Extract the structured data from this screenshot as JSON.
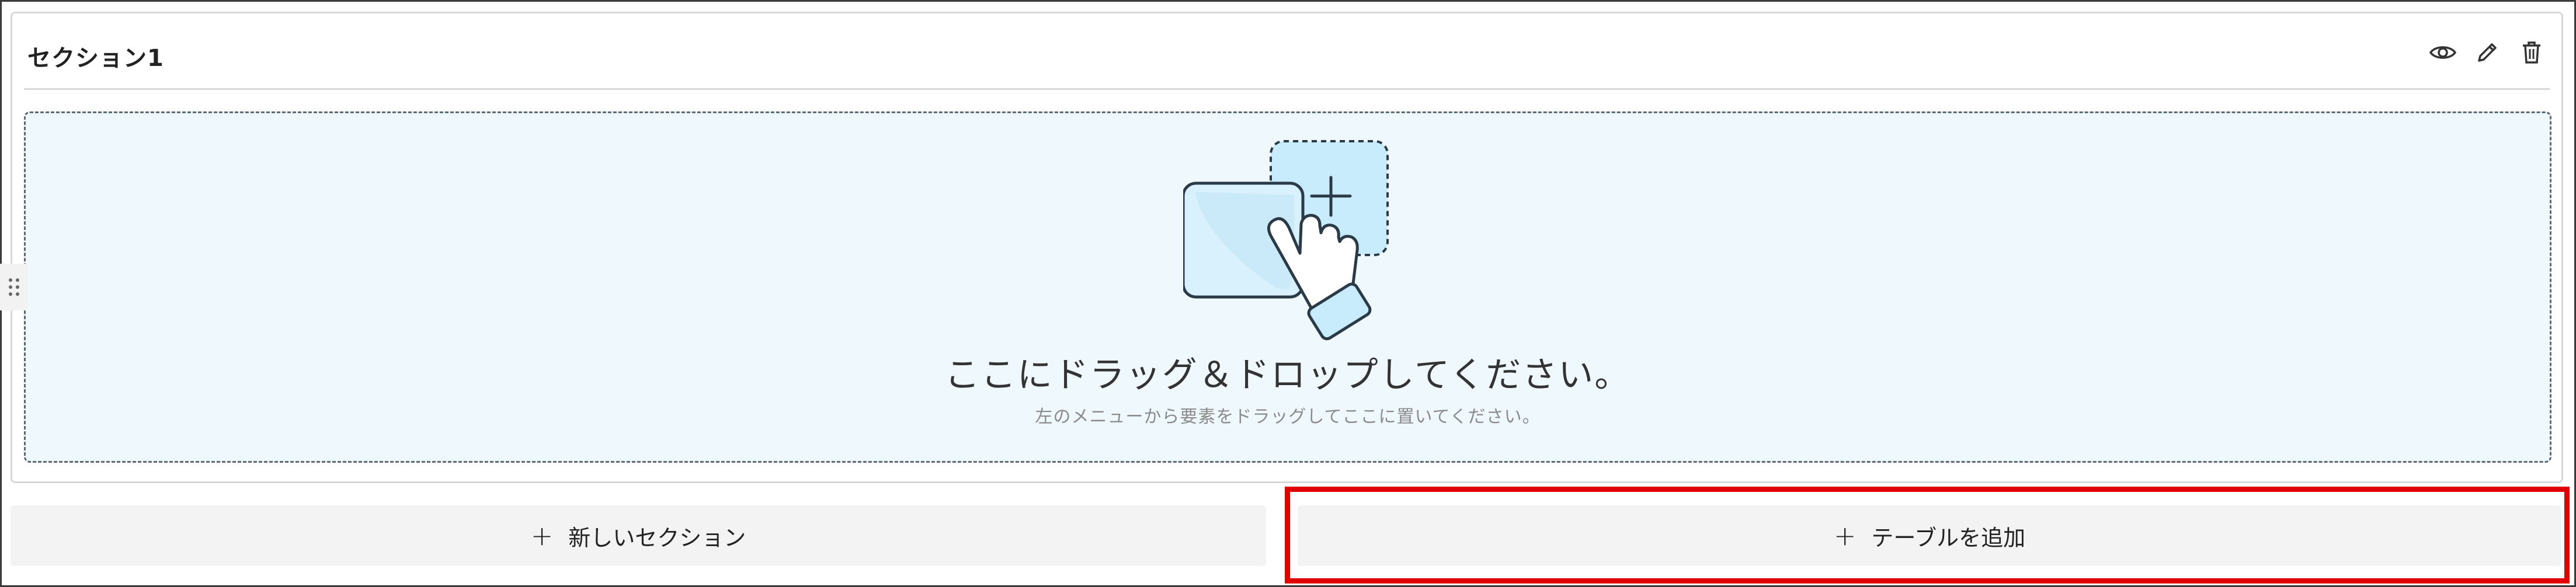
{
  "section": {
    "title": "セクション1",
    "actions": [
      {
        "icon": "eye-icon"
      },
      {
        "icon": "pencil-icon"
      },
      {
        "icon": "trash-icon"
      }
    ]
  },
  "drop_zone": {
    "main_text": "ここにドラッグ＆ドロップしてください。",
    "sub_text": "左のメニューから要素をドラッグしてここに置いてください。"
  },
  "buttons": {
    "new_section_label": "新しいセクション",
    "add_table_label": "テーブルを追加",
    "plus_glyph": "+"
  },
  "colors": {
    "drop_zone_bg": "#eef8fd",
    "button_bg": "#f3f3f3",
    "highlight": "#e00000",
    "illustration_accent": "#c8ecfb"
  }
}
